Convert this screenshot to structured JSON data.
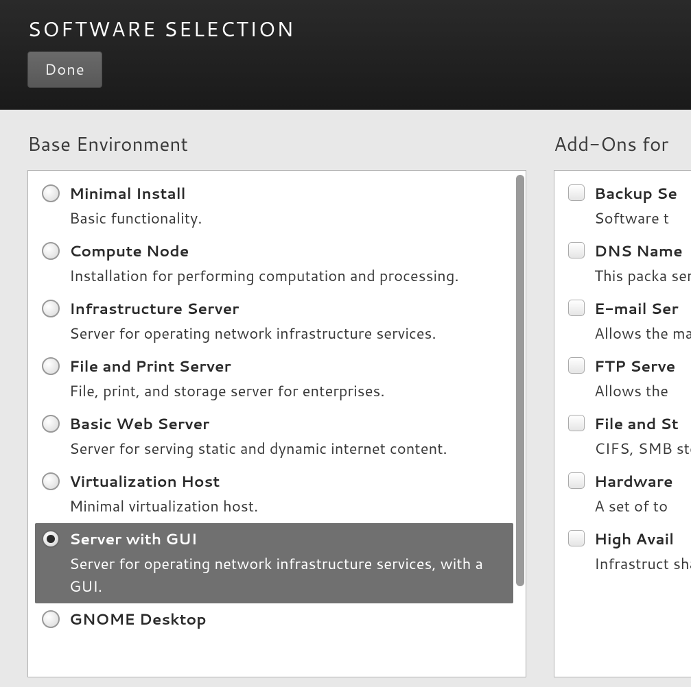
{
  "header": {
    "title": "SOFTWARE SELECTION",
    "done_label": "Done"
  },
  "left": {
    "title": "Base Environment",
    "items": [
      {
        "title": "Minimal Install",
        "desc": "Basic functionality.",
        "selected": false
      },
      {
        "title": "Compute Node",
        "desc": "Installation for performing computation and processing.",
        "selected": false
      },
      {
        "title": "Infrastructure Server",
        "desc": "Server for operating network infrastructure services.",
        "selected": false
      },
      {
        "title": "File and Print Server",
        "desc": "File, print, and storage server for enterprises.",
        "selected": false
      },
      {
        "title": "Basic Web Server",
        "desc": "Server for serving static and dynamic internet content.",
        "selected": false
      },
      {
        "title": "Virtualization Host",
        "desc": "Minimal virtualization host.",
        "selected": false
      },
      {
        "title": "Server with GUI",
        "desc": "Server for operating network infrastructure services, with a GUI.",
        "selected": true
      },
      {
        "title": "GNOME Desktop",
        "desc": "",
        "selected": false
      }
    ]
  },
  "right": {
    "title": "Add-Ons for",
    "items": [
      {
        "title": "Backup Se",
        "desc": "Software t"
      },
      {
        "title": "DNS Name",
        "desc": "This packa server (BIN"
      },
      {
        "title": "E-mail Ser",
        "desc": "Allows the mail server"
      },
      {
        "title": "FTP Serve",
        "desc": "Allows the"
      },
      {
        "title": "File and St",
        "desc": "CIFS, SMB storage se"
      },
      {
        "title": "Hardware",
        "desc": "A set of to"
      },
      {
        "title": "High Avail",
        "desc": "Infrastruct shared sto"
      }
    ]
  }
}
